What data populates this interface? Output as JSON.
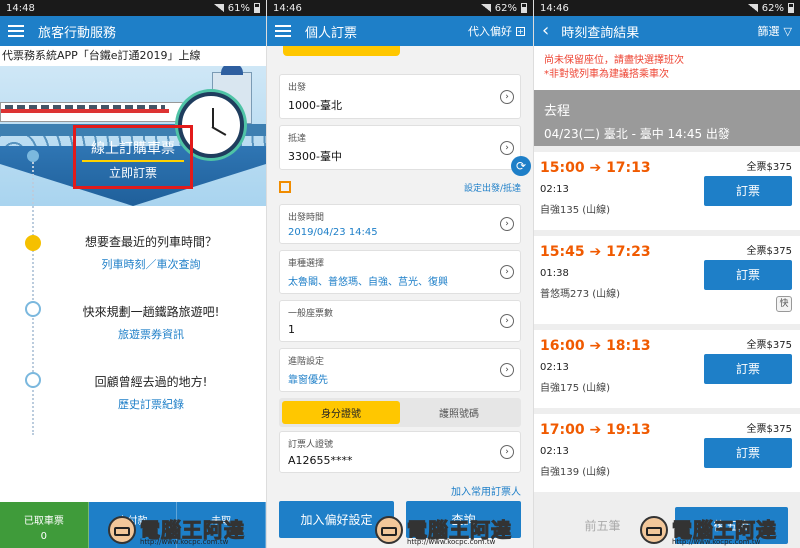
{
  "screen1": {
    "status": {
      "time": "14:48",
      "battery": "61%"
    },
    "app_title": "旅客行動服務",
    "banner": "代票務系統APP「台鐵e訂通2019」上線",
    "cta": {
      "title": "線上訂購車票",
      "sub": "立即訂票"
    },
    "features": [
      {
        "question": "想要查最近的列車時間？",
        "link": "列車時刻／車次查詢"
      },
      {
        "question": "快來規劃一趟鐵路旅遊吧!",
        "link": "旅遊票券資訊"
      },
      {
        "question": "回顧曾經去過的地方!",
        "link": "歷史訂票紀錄"
      }
    ],
    "bottom": [
      {
        "label": "已取車票",
        "count": "0"
      },
      {
        "label": "未付款",
        "count": ""
      },
      {
        "label": "未取",
        "count": ""
      }
    ]
  },
  "screen2": {
    "status": {
      "time": "14:46",
      "battery": "62%"
    },
    "app_title": "個人訂票",
    "pref_label": "代入偏好",
    "fields": {
      "from": {
        "label": "出發",
        "value": "1000-臺北"
      },
      "to": {
        "label": "抵達",
        "value": "3300-臺中"
      },
      "depart_time": {
        "label": "出發時間",
        "value": "2019/04/23 14:45"
      },
      "train_type": {
        "label": "車種選擇",
        "value": "太魯閣、普悠瑪、自強、莒光、復興"
      },
      "tickets": {
        "label": "一般座票數",
        "value": "1"
      },
      "advanced": {
        "label": "進階設定",
        "value": "靠窗優先"
      },
      "id": {
        "label": "訂票人證號",
        "value": "A12655****"
      }
    },
    "set_route_link": "設定出發/抵達",
    "id_tabs": [
      "身分證號",
      "護照號碼"
    ],
    "add_person_link": "加入常用訂票人",
    "actions": {
      "save_pref": "加入偏好設定",
      "query": "查詢"
    }
  },
  "screen3": {
    "status": {
      "time": "14:46",
      "battery": "62%"
    },
    "app_title": "時刻查詢結果",
    "filter_label": "篩選",
    "notice": [
      "尚未保留座位，請盡快選擇班次",
      "*非對號列車為建議搭乘車次"
    ],
    "route": {
      "direction": "去程",
      "summary": "04/23(二) 臺北 - 臺中 14:45 出發"
    },
    "trains": [
      {
        "dep": "15:00",
        "arr": "17:13",
        "duration": "02:13",
        "name": "自強135 (山線)",
        "price": "全票$375",
        "book": "訂票",
        "fast": ""
      },
      {
        "dep": "15:45",
        "arr": "17:23",
        "duration": "01:38",
        "name": "普悠瑪273 (山線)",
        "price": "全票$375",
        "book": "訂票",
        "fast": "快"
      },
      {
        "dep": "16:00",
        "arr": "18:13",
        "duration": "02:13",
        "name": "自強175 (山線)",
        "price": "全票$375",
        "book": "訂票",
        "fast": ""
      },
      {
        "dep": "17:00",
        "arr": "19:13",
        "duration": "02:13",
        "name": "自強139 (山線)",
        "price": "全票$375",
        "book": "訂票",
        "fast": ""
      }
    ],
    "pager": {
      "prev": "前五筆",
      "next": "後五筆"
    }
  },
  "watermark": {
    "text": "電腦王阿達",
    "url": "http://www.kocpc.com.tw"
  },
  "colors": {
    "primary": "#1e7fc8",
    "accent": "#ffc700",
    "time_orange": "#f05a00",
    "highlight_red": "#e21b1b"
  }
}
